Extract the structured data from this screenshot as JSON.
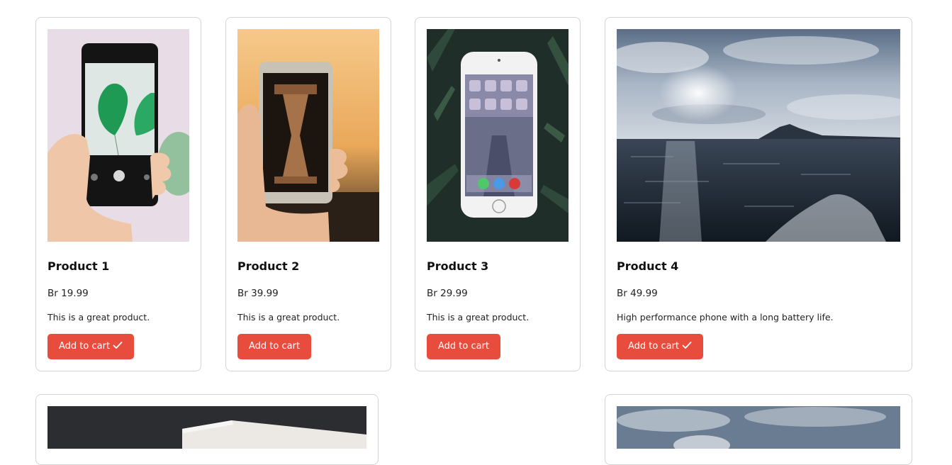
{
  "products": [
    {
      "name": "Product 1",
      "price": "Br 19.99",
      "description": "This is a great product.",
      "button_label": "Add to cart",
      "in_cart": true,
      "image": "phone-camera-leaf-photo"
    },
    {
      "name": "Product 2",
      "price": "Br 39.99",
      "description": "This is a great product.",
      "button_label": "Add to cart",
      "in_cart": false,
      "image": "phone-hourglass-photo"
    },
    {
      "name": "Product 3",
      "price": "Br 29.99",
      "description": "This is a great product.",
      "button_label": "Add to cart",
      "in_cart": false,
      "image": "iphone-on-leaves-photo"
    },
    {
      "name": "Product 4",
      "price": "Br 49.99",
      "description": "High performance phone with a long battery life.",
      "button_label": "Add to cart",
      "in_cart": true,
      "image": "ocean-island-photo"
    }
  ],
  "partial_products": [
    {
      "image": "white-box-photo"
    },
    {
      "image": "ocean-island-photo"
    }
  ],
  "colors": {
    "button": "#e74c3c",
    "button_text": "#ffffff",
    "card_border": "#d4d4d4"
  },
  "icons": {
    "in_cart": "check-icon"
  }
}
